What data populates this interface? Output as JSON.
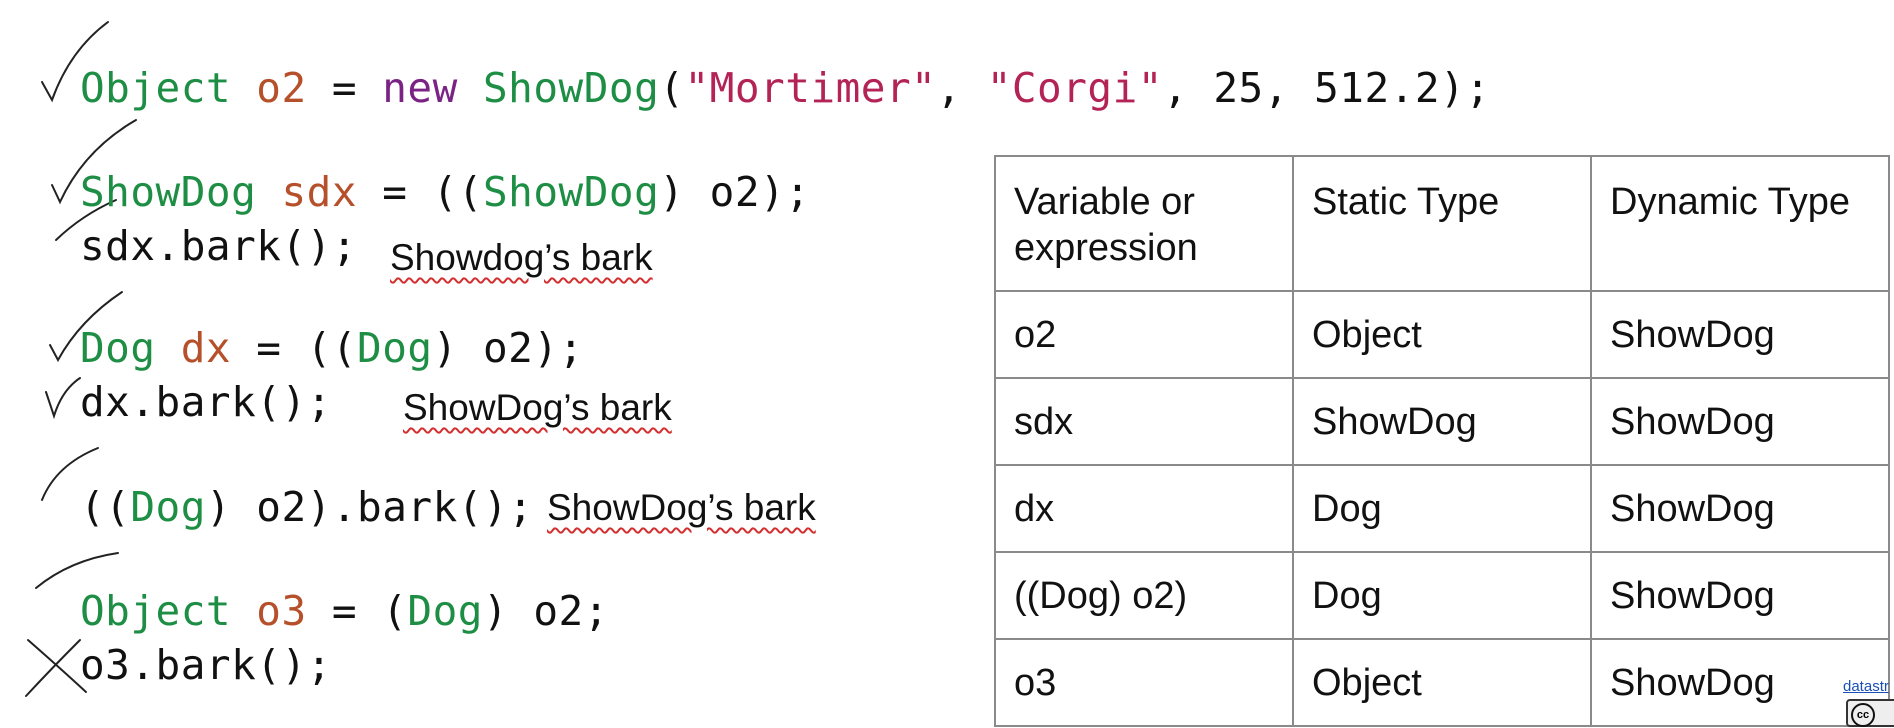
{
  "code": {
    "line1": {
      "t1": "Object",
      "v1": "o2",
      "eq": " = ",
      "new": "new",
      "t2": "ShowDog",
      "open": "(",
      "s1": "\"Mortimer\"",
      "sep1": ", ",
      "s2": "\"Corgi\"",
      "rest": ", 25, 512.2);"
    },
    "line2": {
      "t1": "ShowDog",
      "v1": "sdx",
      "eq": " = ((",
      "t2": "ShowDog",
      "rest": ") o2);"
    },
    "line3": {
      "text": "sdx.bark();"
    },
    "line4": {
      "t1": "Dog",
      "v1": "dx",
      "eq": " = ((",
      "t2": "Dog",
      "rest": ") o2);"
    },
    "line5": {
      "text": "dx.bark();"
    },
    "line6": {
      "pre": "((",
      "t1": "Dog",
      "rest": ") o2).bark();"
    },
    "line7": {
      "t1": "Object",
      "v1": "o3",
      "eq": " = (",
      "t2": "Dog",
      "rest": ") o2;"
    },
    "line8": {
      "text": "o3.bark();"
    }
  },
  "notes": {
    "note1": "Showdog’s bark",
    "note2": "ShowDog’s bark",
    "note3": "ShowDog’s bark"
  },
  "table": {
    "headers": [
      "Variable or\nexpression",
      "Static Type",
      "Dynamic Type"
    ],
    "rows": [
      [
        "o2",
        "Object",
        "ShowDog"
      ],
      [
        "sdx",
        "ShowDog",
        "ShowDog"
      ],
      [
        "dx",
        "Dog",
        "ShowDog"
      ],
      [
        "((Dog) o2)",
        "Dog",
        "ShowDog"
      ],
      [
        "o3",
        "Object",
        "ShowDog"
      ]
    ]
  },
  "footer": {
    "credit": "datastr",
    "cc_label": "cc"
  },
  "colors": {
    "type": "#1e8e45",
    "variable": "#b5502a",
    "keyword": "#7a2385",
    "string": "#b32356",
    "ink": "#111111"
  }
}
